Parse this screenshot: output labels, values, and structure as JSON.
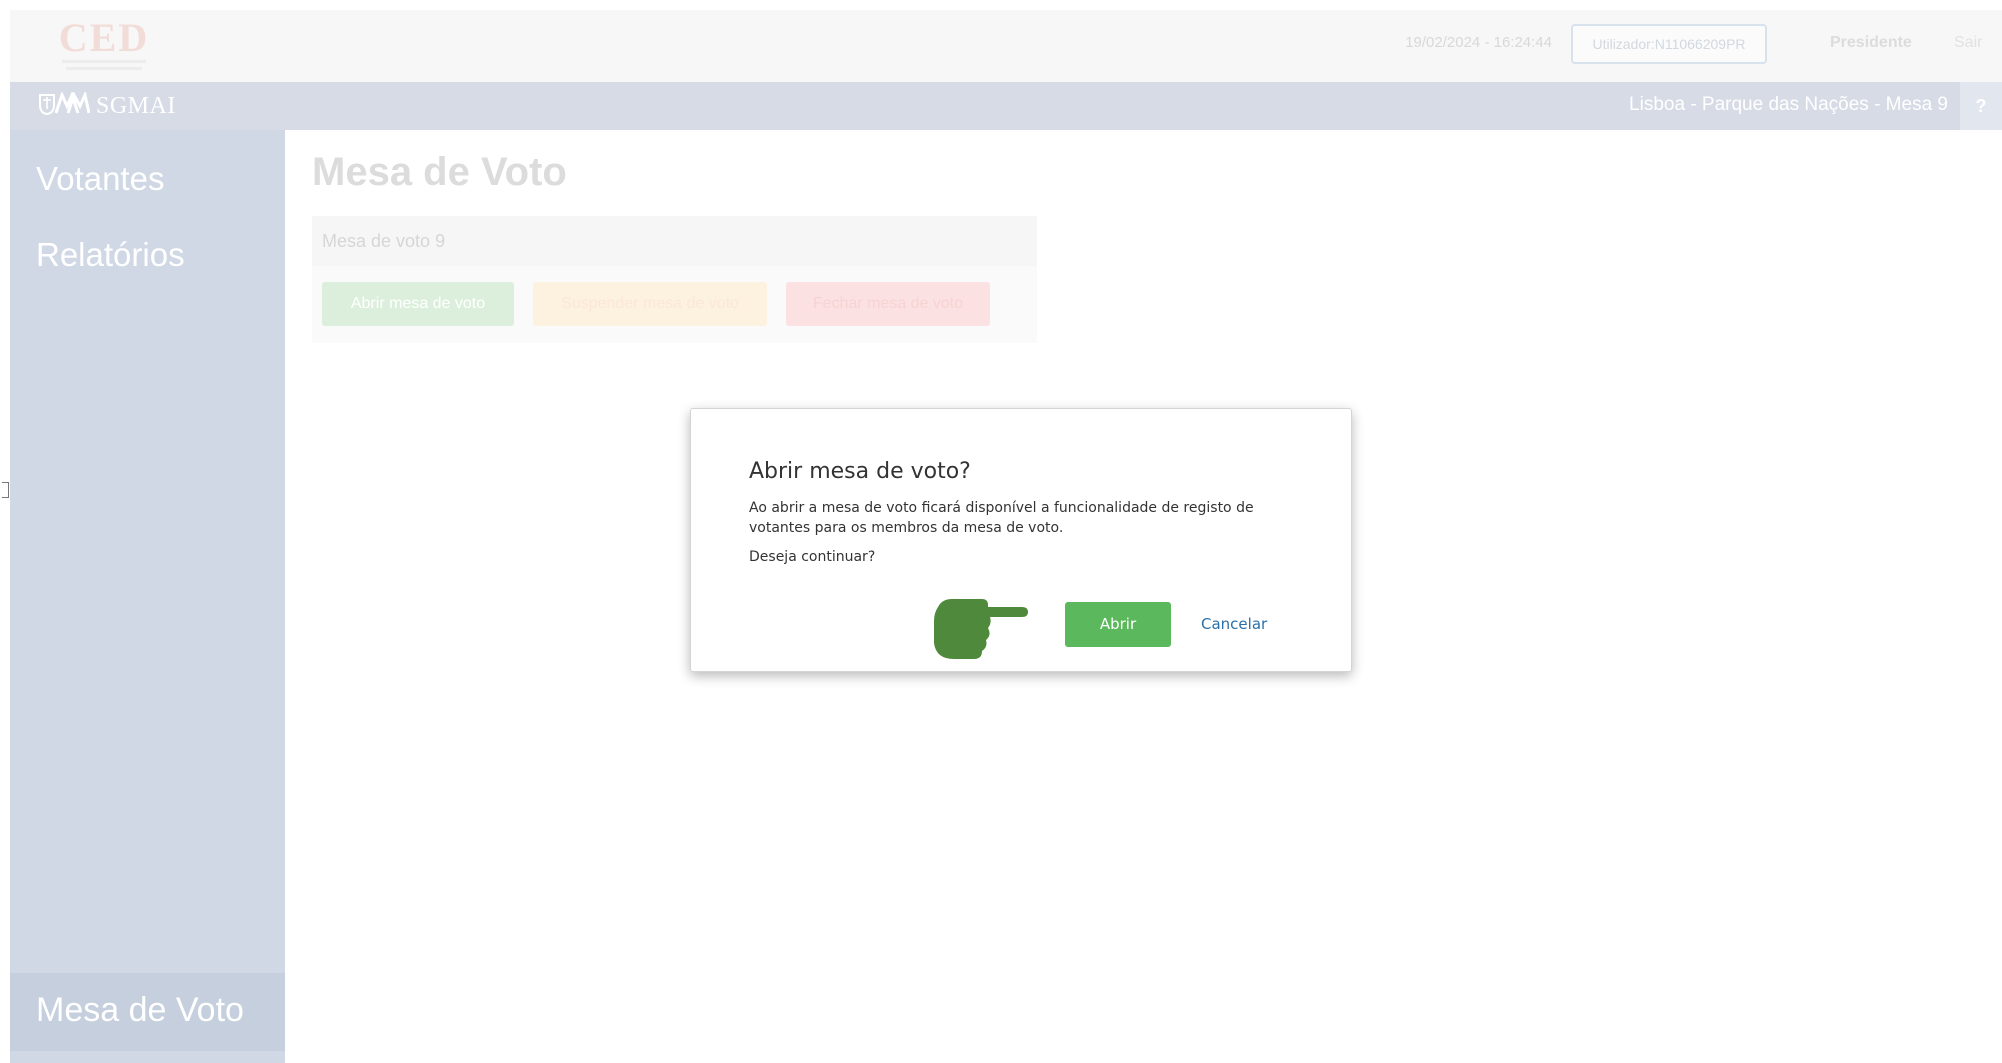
{
  "header": {
    "logo_text": "CED",
    "datetime": "19/02/2024 - 16:24:44",
    "user": "Utilizador:N11066209PR",
    "role": "Presidente",
    "logout": "Sair"
  },
  "subbar": {
    "brand": "SGMAI",
    "location": "Lisboa - Parque das Nações - Mesa 9",
    "help": "?"
  },
  "sidebar": {
    "items": [
      {
        "label": "Votantes"
      },
      {
        "label": "Relatórios"
      }
    ],
    "bottom_item": "Mesa de Voto"
  },
  "main": {
    "title": "Mesa de Voto",
    "panel_title": "Mesa de voto 9",
    "buttons": {
      "open": "Abrir mesa de voto",
      "suspend": "Suspender mesa de voto",
      "close": "Fechar mesa de voto"
    }
  },
  "modal": {
    "title": "Abrir mesa de voto?",
    "message": "Ao abrir a mesa de voto ficará disponível a funcionalidade de registo de votantes para os membros da mesa de voto.",
    "question": "Deseja continuar?",
    "confirm": "Abrir",
    "cancel": "Cancelar"
  },
  "colors": {
    "confirm_button": "#5cb85c",
    "cancel_link": "#2a6fa8",
    "pointer_hand": "#4f8a3c",
    "sidebar": "#d0d8e6"
  },
  "icons": {
    "brand": "sgmai-logo-icon",
    "pointer": "pointing-hand-icon"
  }
}
